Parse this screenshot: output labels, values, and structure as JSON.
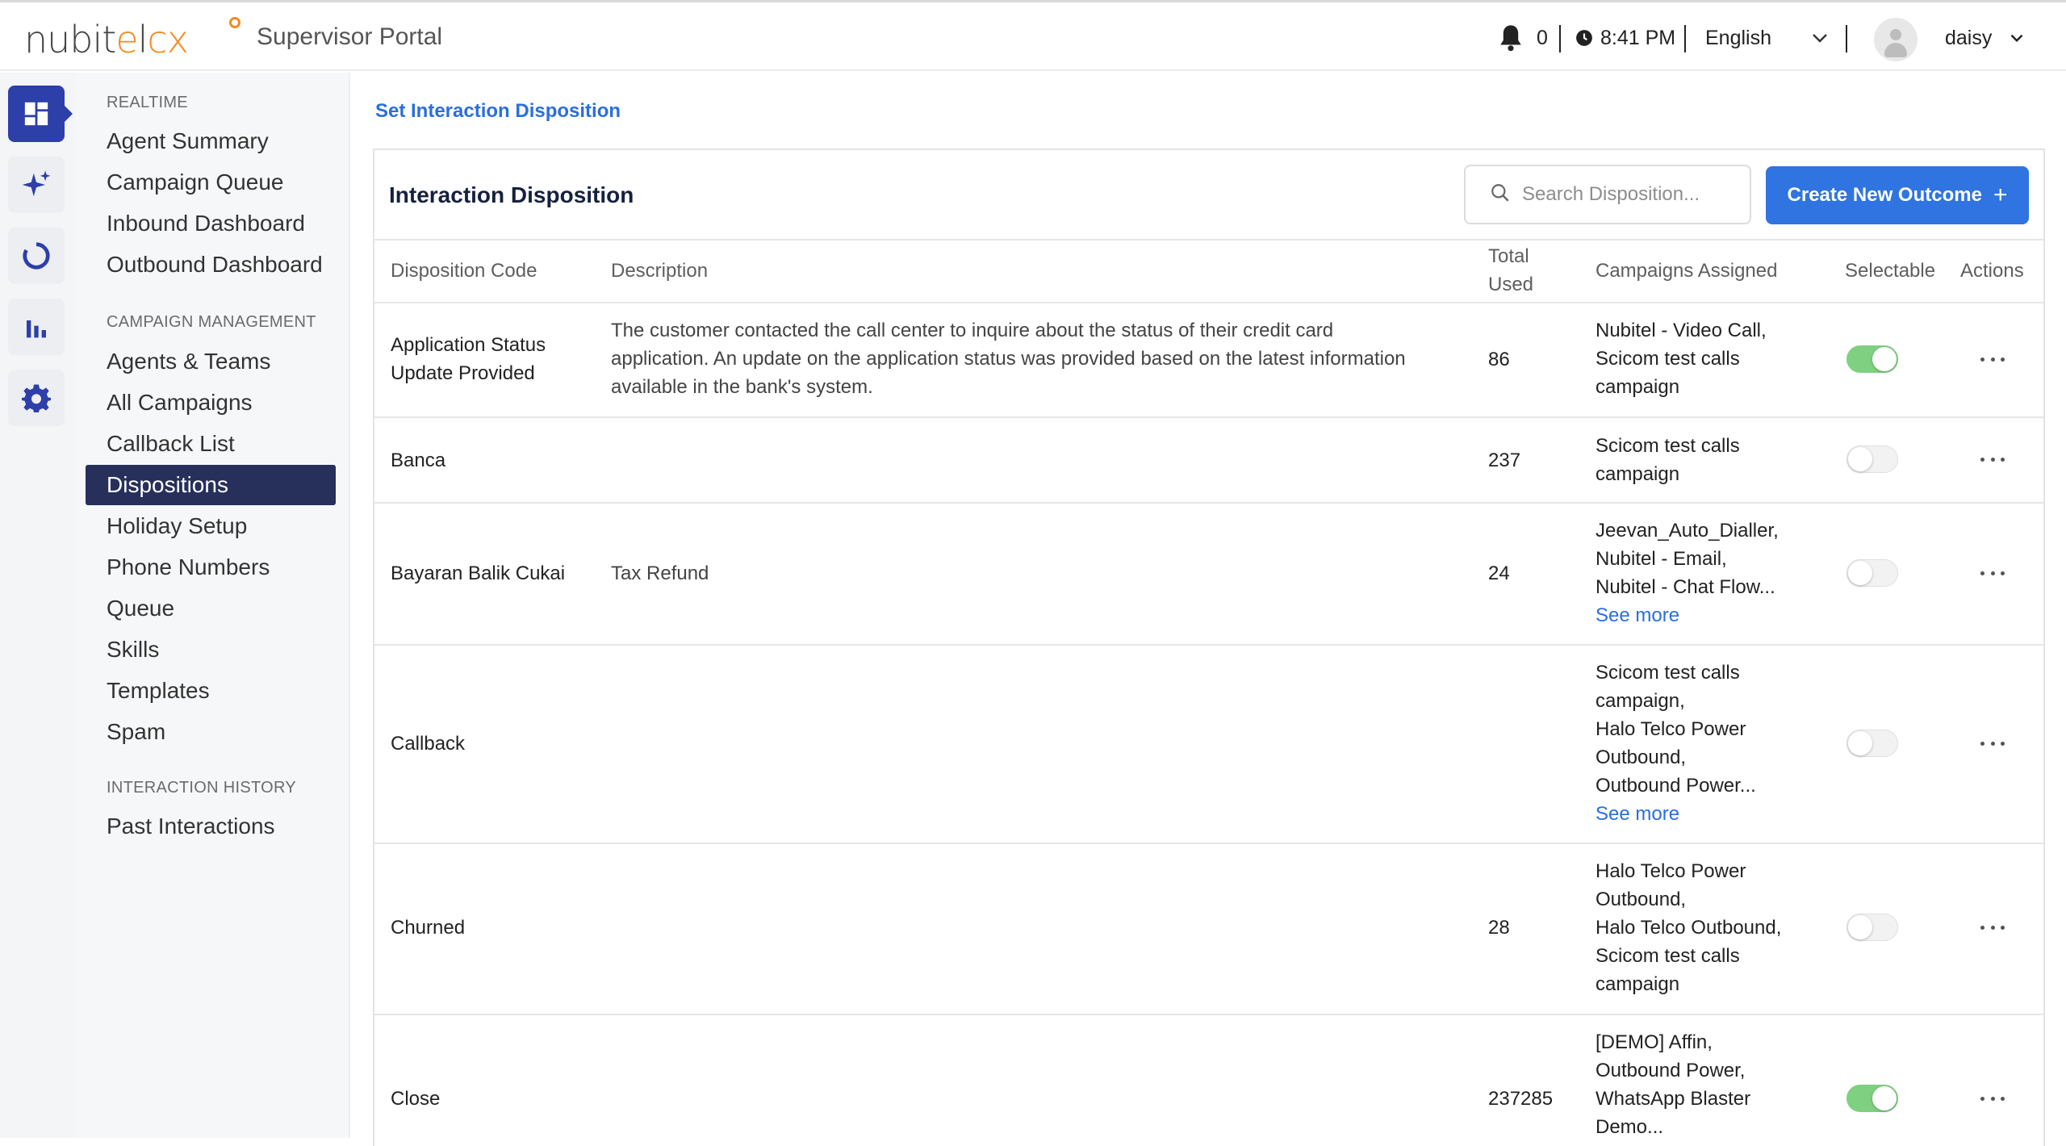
{
  "app": {
    "logo": {
      "part1": "nubit",
      "part2": "e",
      "part3": "l",
      "part4": "cx"
    },
    "portal_title": "Supervisor Portal"
  },
  "header": {
    "notification_count": "0",
    "time": "8:41 PM",
    "language": "English",
    "username": "daisy"
  },
  "rail": {
    "icons": [
      "dashboard-icon",
      "sparkle-icon",
      "loading-circle-icon",
      "bar-chart-icon",
      "gear-icon"
    ],
    "active_color": "#2d3fa8"
  },
  "sidebar": {
    "sections": [
      {
        "heading": "REALTIME",
        "items": [
          "Agent Summary",
          "Campaign Queue",
          "Inbound Dashboard",
          "Outbound Dashboard"
        ]
      },
      {
        "heading": "CAMPAIGN MANAGEMENT",
        "items": [
          "Agents & Teams",
          "All Campaigns",
          "Callback List",
          "Dispositions",
          "Holiday Setup",
          "Phone Numbers",
          "Queue",
          "Skills",
          "Templates",
          "Spam"
        ]
      },
      {
        "heading": "INTERACTION HISTORY",
        "items": [
          "Past Interactions"
        ]
      }
    ],
    "active_item": "Dispositions"
  },
  "main": {
    "breadcrumb": "Set Interaction Disposition",
    "card_title": "Interaction Disposition",
    "search_placeholder": "Search Disposition...",
    "create_button": "Create New Outcome",
    "create_button_icon": "+",
    "columns": {
      "code": "Disposition Code",
      "description": "Description",
      "total_used_1": "Total",
      "total_used_2": "Used",
      "campaigns": "Campaigns Assigned",
      "selectable": "Selectable",
      "actions": "Actions"
    },
    "rows": [
      {
        "code_lines": [
          "Application Status",
          "Update Provided"
        ],
        "description_lines": [
          "The customer contacted the call center to inquire about the status of their credit card",
          "application. An update on the application status was provided based on the latest information",
          "available in the bank's system."
        ],
        "total": "86",
        "campaign_lines": [
          "Nubitel - Video Call,",
          "Scicom test calls",
          "campaign"
        ],
        "see_more": "",
        "selectable": true
      },
      {
        "code_lines": [
          "Banca"
        ],
        "description_lines": [],
        "total": "237",
        "campaign_lines": [
          "Scicom test calls",
          "campaign"
        ],
        "see_more": "",
        "selectable": false
      },
      {
        "code_lines": [
          "Bayaran Balik Cukai"
        ],
        "description_lines": [
          "Tax Refund"
        ],
        "total": "24",
        "campaign_lines": [
          "Jeevan_Auto_Dialler,",
          "Nubitel - Email,",
          "Nubitel - Chat Flow..."
        ],
        "see_more": "See more",
        "selectable": false
      },
      {
        "code_lines": [
          "Callback"
        ],
        "description_lines": [],
        "total": "",
        "campaign_lines": [
          "Scicom test calls",
          "campaign,",
          "Halo Telco Power",
          "Outbound,",
          "Outbound Power..."
        ],
        "see_more": "See more",
        "selectable": false
      },
      {
        "code_lines": [
          "Churned"
        ],
        "description_lines": [],
        "total": "28",
        "campaign_lines": [
          "Halo Telco Power",
          "Outbound,",
          "Halo Telco Outbound,",
          "Scicom test calls",
          "campaign"
        ],
        "see_more": "",
        "selectable": false
      },
      {
        "code_lines": [
          "Close"
        ],
        "description_lines": [],
        "total": "237285",
        "campaign_lines": [
          "[DEMO] Affin,",
          "Outbound Power,",
          "WhatsApp Blaster",
          "Demo..."
        ],
        "see_more": "",
        "selectable": true
      }
    ]
  },
  "colors": {
    "brand_orange": "#f58a1f",
    "primary_blue": "#2f74e0",
    "link_blue": "#2a6fdc",
    "nav_active": "#26305a",
    "toggle_on": "#7fd081"
  }
}
